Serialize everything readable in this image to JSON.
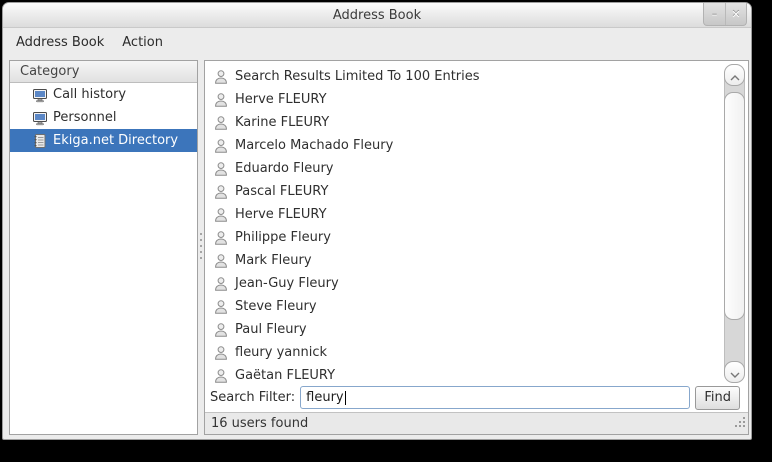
{
  "window": {
    "title": "Address Book",
    "controls": [
      {
        "name": "minimize-button",
        "glyph": "–"
      },
      {
        "name": "close-button",
        "glyph": "✕"
      }
    ]
  },
  "menubar": {
    "items": [
      {
        "label": "Address Book"
      },
      {
        "label": "Action"
      }
    ]
  },
  "sidebar": {
    "header": "Category",
    "items": [
      {
        "label": "Call history",
        "icon": "computer-icon",
        "selected": false
      },
      {
        "label": "Personnel",
        "icon": "computer-icon",
        "selected": false
      },
      {
        "label": "Ekiga.net Directory",
        "icon": "directory-icon",
        "selected": true
      }
    ]
  },
  "main": {
    "entries": [
      "Search Results Limited To 100 Entries",
      "Herve FLEURY",
      "Karine FLEURY",
      "Marcelo Machado Fleury",
      "Eduardo Fleury",
      "Pascal FLEURY",
      "Herve FLEURY",
      "Philippe Fleury",
      "Mark Fleury",
      "Jean-Guy Fleury",
      "Steve Fleury",
      "Paul Fleury",
      "fleury yannick",
      "Gaëtan FLEURY"
    ],
    "search": {
      "label": "Search Filter:",
      "value": "fleury",
      "button": "Find"
    },
    "status": "16 users found"
  },
  "colors": {
    "selection": "#3c75bb",
    "selection_text": "#ffffff",
    "entry_focus_border": "#87a7cc"
  }
}
